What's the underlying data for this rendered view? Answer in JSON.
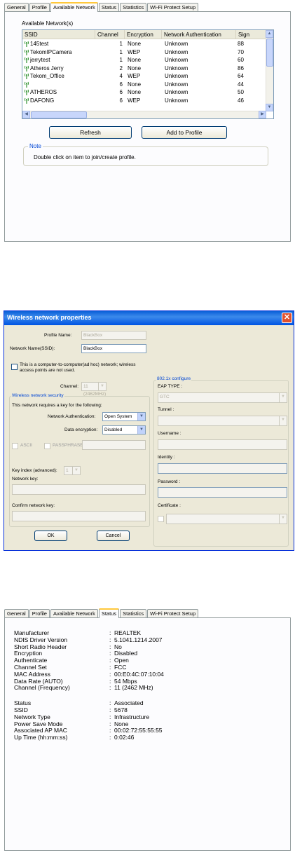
{
  "panel1": {
    "tabs": [
      "General",
      "Profile",
      "Available Network",
      "Status",
      "Statistics",
      "Wi-Fi Protect Setup"
    ],
    "active_tab": "Available Network",
    "group_label": "Available Network(s)",
    "columns": [
      "SSID",
      "Channel",
      "Encryption",
      "Network Authentication",
      "Sign"
    ],
    "rows": [
      {
        "ssid": "145test",
        "channel": "1",
        "encryption": "None",
        "auth": "Unknown",
        "signal": "88"
      },
      {
        "ssid": "TekomIPCamera",
        "channel": "1",
        "encryption": "WEP",
        "auth": "Unknown",
        "signal": "70"
      },
      {
        "ssid": "jerrytest",
        "channel": "1",
        "encryption": "None",
        "auth": "Unknown",
        "signal": "60"
      },
      {
        "ssid": "Atheros Jerry",
        "channel": "2",
        "encryption": "None",
        "auth": "Unknown",
        "signal": "86"
      },
      {
        "ssid": "Tekom_Office",
        "channel": "4",
        "encryption": "WEP",
        "auth": "Unknown",
        "signal": "64"
      },
      {
        "ssid": "",
        "channel": "6",
        "encryption": "None",
        "auth": "Unknown",
        "signal": "44"
      },
      {
        "ssid": "ATHEROS",
        "channel": "6",
        "encryption": "None",
        "auth": "Unknown",
        "signal": "50"
      },
      {
        "ssid": "DAFONG",
        "channel": "6",
        "encryption": "WEP",
        "auth": "Unknown",
        "signal": "46"
      }
    ],
    "refresh_label": "Refresh",
    "add_label": "Add to Profile",
    "note_label": "Note",
    "note_text": "Double click on item to join/create profile."
  },
  "panel2": {
    "title": "Wireless network properties",
    "close_glyph": "✕",
    "profile_name_label": "Profile Name:",
    "profile_name_value": "BlackBox",
    "ssid_label": "Network Name(SSID):",
    "ssid_value": "BlackBox",
    "adhoc_label_1": "This is a computer-to-computer(ad hoc) network; wireless",
    "adhoc_label_2": "access points are not used.",
    "channel_label": "Channel:",
    "channel_value": "11 (2462MHz)",
    "security_group": "Wireless network security",
    "security_text": "This network requires a key for the following:",
    "auth_label": "Network Authentication:",
    "auth_value": "Open System",
    "enc_label": "Data encryption:",
    "enc_value": "Disabled",
    "ascii_label": "ASCII",
    "pass_label": "PASSPHRASE",
    "keyindex_label": "Key index (advanced):",
    "keyindex_value": "1",
    "netkey_label": "Network key:",
    "confirm_label": "Confirm network key:",
    "ok_label": "OK",
    "cancel_label": "Cancel",
    "dot1x_group": "802.1x configure",
    "eap_label": "EAP TYPE :",
    "eap_value": "GTC",
    "tunnel_label": "Tunnel :",
    "username_label": "Username :",
    "identity_label": "Identity :",
    "password_label": "Password :",
    "certificate_label": "Certificate :"
  },
  "panel3": {
    "tabs": [
      "General",
      "Profile",
      "Available Network",
      "Status",
      "Statistics",
      "Wi-Fi Protect Setup"
    ],
    "active_tab": "Status",
    "rows": [
      {
        "label": "Manufacturer",
        "value": "REALTEK"
      },
      {
        "label": "NDIS Driver Version",
        "value": "5.1041.1214.2007"
      },
      {
        "label": "Short Radio Header",
        "value": "No"
      },
      {
        "label": "Encryption",
        "value": "Disabled"
      },
      {
        "label": "Authenticate",
        "value": "Open"
      },
      {
        "label": "Channel Set",
        "value": "FCC"
      },
      {
        "label": "MAC Address",
        "value": "00:E0:4C:07:10:04"
      },
      {
        "label": "Data Rate (AUTO)",
        "value": "54 Mbps"
      },
      {
        "label": "Channel (Frequency)",
        "value": "11 (2462 MHz)"
      },
      {
        "label": "Status",
        "value": "Associated"
      },
      {
        "label": "SSID",
        "value": "5678"
      },
      {
        "label": "Network Type",
        "value": "Infrastructure"
      },
      {
        "label": "Power Save Mode",
        "value": "None"
      },
      {
        "label": "Associated AP MAC",
        "value": "00:02:72:55:55:55"
      },
      {
        "label": "Up Time (hh:mm:ss)",
        "value": "0:02:46"
      }
    ],
    "separator": ":"
  },
  "colors": {
    "accent_tab": "#ffc83c",
    "xp_blue": "#0054e3",
    "group_label": "#0046d5",
    "signal_icon": "#2a8f2a"
  }
}
